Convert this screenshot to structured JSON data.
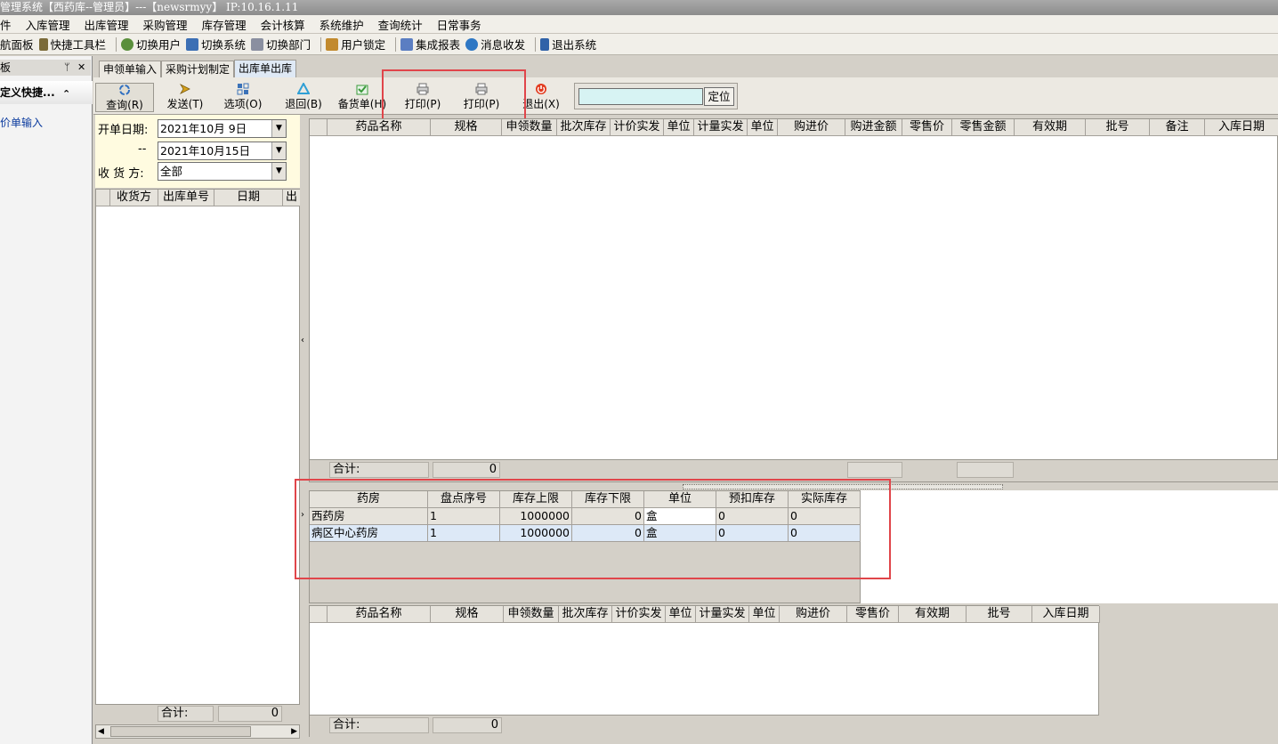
{
  "window": {
    "title": "管理系统【西药库--管理员】---【newsrmyy】  IP:10.16.1.11"
  },
  "menu": {
    "items": [
      "件",
      "入库管理",
      "出库管理",
      "采购管理",
      "库存管理",
      "会计核算",
      "系统维护",
      "查询统计",
      "日常事务"
    ]
  },
  "quickbar": {
    "items": [
      {
        "label": "航面板",
        "icon": "panel-icon"
      },
      {
        "label": "快捷工具栏",
        "icon": "toolbar-icon"
      },
      {
        "label": "切换用户",
        "icon": "switch-user-icon"
      },
      {
        "label": "切换系统",
        "icon": "switch-system-icon"
      },
      {
        "label": "切换部门",
        "icon": "switch-dept-icon"
      },
      {
        "label": "用户锁定",
        "icon": "lock-user-icon"
      },
      {
        "label": "集成报表",
        "icon": "report-icon"
      },
      {
        "label": "消息收发",
        "icon": "message-icon"
      },
      {
        "label": "退出系统",
        "icon": "exit-icon"
      }
    ]
  },
  "leftpanel": {
    "header": "板",
    "fold_title": "定义快捷...",
    "fold_arrow": "⌃",
    "item": "价单输入",
    "pin": "ᛘ",
    "close": "✕"
  },
  "tabs": [
    "申领单输入",
    "采购计划制定",
    "出库单出库"
  ],
  "toolbar": {
    "buttons": [
      {
        "label": "查询(R)",
        "icon": "refresh-icon",
        "color": "#2f6fc0"
      },
      {
        "label": "发送(T)",
        "icon": "send-icon",
        "color": "#d7a21b"
      },
      {
        "label": "选项(O)",
        "icon": "options-icon",
        "color": "#3b72b8"
      },
      {
        "label": "退回(B)",
        "icon": "recycle-icon",
        "color": "#2f9fd5"
      },
      {
        "label": "备货单(H)",
        "icon": "checklist-icon",
        "color": "#3a9a3a"
      },
      {
        "label": "打印(P)",
        "icon": "printer-icon",
        "color": "#6d6d6d"
      },
      {
        "label": "打印(P)",
        "icon": "printer-icon",
        "color": "#6d6d6d"
      },
      {
        "label": "退出(X)",
        "icon": "power-icon",
        "color": "#e23a1e"
      }
    ],
    "locate_value": "",
    "locate_label": "定位"
  },
  "filter": {
    "date_label": "开单日期:",
    "date_from": "2021年10月 9日",
    "dash": "--",
    "date_to": "2021年10月15日",
    "receiver_label": "收 货 方:",
    "receiver_value": "全部"
  },
  "leftgrid": {
    "columns": [
      "收货方",
      "出库单号",
      "日期",
      "出"
    ],
    "sum_label": "合计:",
    "sum_value": "0"
  },
  "topgrid": {
    "columns": [
      "药品名称",
      "规格",
      "申领数量",
      "批次库存",
      "计价实发",
      "单位",
      "计量实发",
      "单位",
      "购进价",
      "购进金额",
      "零售价",
      "零售金额",
      "有效期",
      "批号",
      "备注",
      "入库日期"
    ],
    "sum_label": "合计:",
    "sum_value": "0"
  },
  "stockgrid": {
    "columns": [
      "药房",
      "盘点序号",
      "库存上限",
      "库存下限",
      "单位",
      "预扣库存",
      "实际库存"
    ],
    "rows": [
      [
        "西药房",
        "1",
        "1000000",
        "0",
        "盒",
        "0",
        "0"
      ],
      [
        "病区中心药房",
        "1",
        "1000000",
        "0",
        "盒",
        "0",
        "0"
      ]
    ]
  },
  "bottomgrid": {
    "columns": [
      "药品名称",
      "规格",
      "申领数量",
      "批次库存",
      "计价实发",
      "单位",
      "计量实发",
      "单位",
      "购进价",
      "零售价",
      "有效期",
      "批号",
      "入库日期"
    ],
    "sum_label": "合计:",
    "sum_value": "0"
  },
  "colors": {
    "highlight": "#e0454a",
    "selected_row": "#dde9f7",
    "filter_bg": "#fffbe0"
  }
}
